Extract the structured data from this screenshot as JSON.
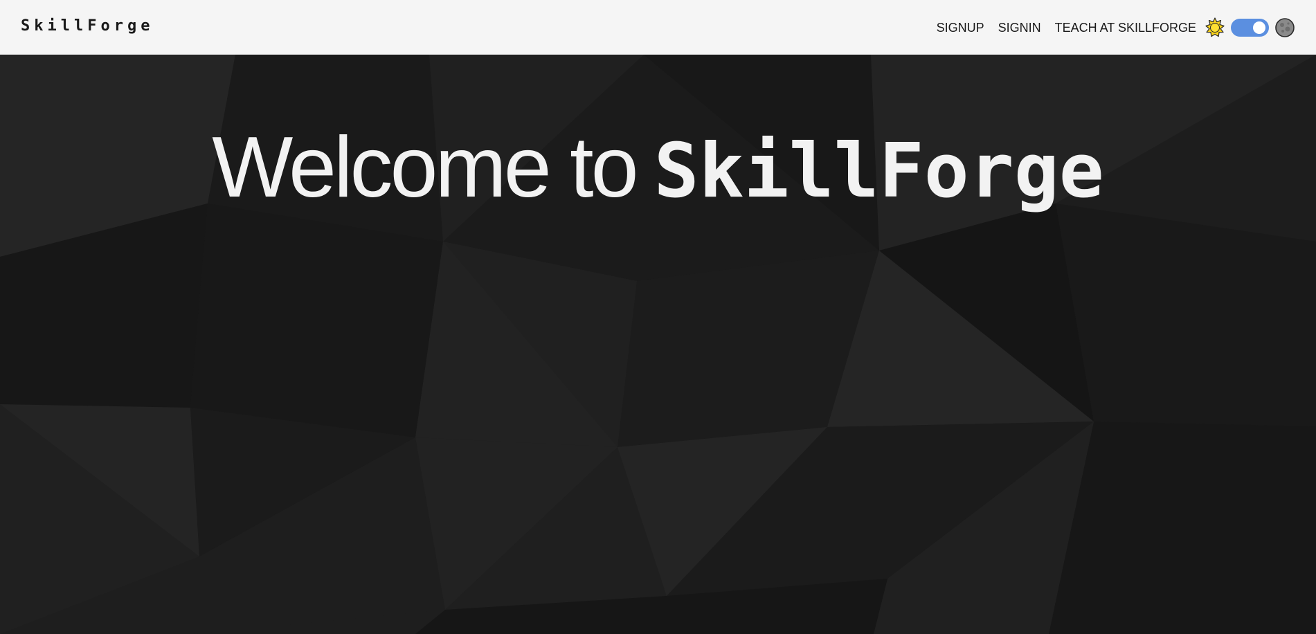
{
  "navbar": {
    "brand": "SkillForge",
    "links": {
      "signup": "SIGNUP",
      "signin": "SIGNIN",
      "teach": "TEACH AT SKILLFORGE"
    },
    "theme_toggle": {
      "state": "on",
      "light_icon": "sun-icon",
      "dark_icon": "moon-icon"
    }
  },
  "hero": {
    "title_prefix": "Welcome to",
    "title_brand": "SkillForge"
  },
  "colors": {
    "navbar_bg": "#f5f5f5",
    "hero_bg": "#1e1e1e",
    "hero_text": "#f2f2f2",
    "toggle_accent": "#5b8fe0",
    "sun": "#f7d21c"
  }
}
